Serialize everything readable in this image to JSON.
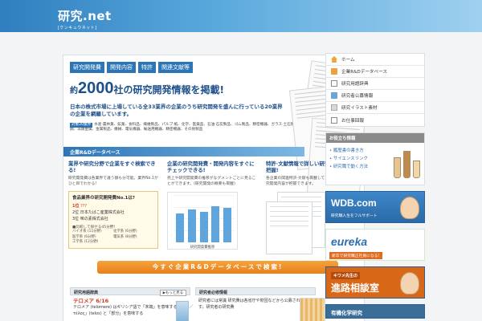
{
  "site": {
    "logo_main": "研究.net",
    "logo_sub": "[ケンキュウネット]"
  },
  "hero": {
    "tags": [
      "研究開発費",
      "開発内容",
      "特許",
      "関連文献等"
    ],
    "headline_pre": "約",
    "headline_num": "2000",
    "headline_post": "社の研究開発情報を掲載!",
    "subline": "日本の株式市場に上場している全33業界の企業のうち研究開発を盛んに行っている20業界の企業を網羅しています。",
    "industries_label": "対象20業界",
    "industries": "水産·農林業、鉱業、食料品、繊維製品、パルプ·紙、化学、医薬品、石油·石炭製品、ゴム製品、精密機器、ガラス·土石製品、鉄鋼、非鉄金属、金属製品、機械、電気機器、輸送用機器、精密機器、その他製品",
    "band": "企業R&Dデータベース",
    "cta": "今すぐ企業R&Dデータベースで検索!"
  },
  "columns": [
    {
      "title": "業界や研究分野で企業をすぐ検索できる!",
      "body": "研究開発費は各業界で違う額も分可能。業界No.1がひと目でわかる!"
    },
    {
      "title": "企業の研究開発費・開発内容をすぐにチェックできる!",
      "body": "売上や研究開発費の推移がなグメントごとに見ることができます。(研究開発の概要も掲載)",
      "chart_caption": "研究開発費推移"
    },
    {
      "title": "特許·文献情報で詳しい研究開発内容を把握!",
      "body": "各企業の関連特許·文献も掲載しています。詳しい研究開発内容が把握できます。"
    }
  ],
  "ranking": {
    "title": "食品業界の研究開発費No.1は?",
    "rows": [
      {
        "rank": "1位",
        "name": "???"
      },
      {
        "rank": "2位",
        "name": "日本たばこ産業株式会社"
      },
      {
        "rank": "3位",
        "name": "味の素株式会社"
      }
    ],
    "sub": "■比較して探せる45分野!",
    "grid": [
      "バイオ系 (11分野)",
      "化学系 (6分野)",
      "医学系 (6分野)",
      "電気系 (8分野)",
      "工学系 (12分野)",
      ""
    ]
  },
  "lower": {
    "glossary_title": "研究用語辞典",
    "glossary_more": "▶もっと見る",
    "word": "テロメア 6/16",
    "word_body": "テロメア (telomere) はギリシア語で「末端」を意味する「テロ／τέλος」(telos) と「部分」を意味する",
    "info_title": "研究者必修情報",
    "info_body": "研究者には常識 研究費は各省庁や財団などから公募されています。研究者の研究費"
  },
  "sidebar": {
    "nav": [
      {
        "label": "ホーム",
        "icon": "home-icon"
      },
      {
        "label": "企業R&Dデータベース",
        "icon": "folder-icon"
      },
      {
        "label": "研究用語辞典",
        "icon": "book-icon"
      },
      {
        "label": "研究者公募情報",
        "icon": "office-icon"
      },
      {
        "label": "研究イラスト素材",
        "icon": "pen-icon"
      },
      {
        "label": "お仕事回報",
        "icon": "mail-icon"
      }
    ],
    "help": {
      "title": "お役立ち情報",
      "links": [
        "履歴書の書き方",
        "サイエンスリンク",
        "研究職で動く方法"
      ]
    },
    "banners": {
      "wdb_title": "WDB.com",
      "wdb_sub": "研究職人生をフルサポート",
      "eureka_title": "eureka",
      "eureka_sub": "新卒で研究職正社員になる!",
      "kigu_top": "キワメ先生の",
      "kigu_title": "進路相談室",
      "last_title": "有機化学研究"
    }
  },
  "chart_data": {
    "type": "bar",
    "categories": [
      "2007",
      "2008",
      "2009",
      "2010",
      "2011"
    ],
    "values": [
      62,
      70,
      66,
      78,
      74
    ],
    "title": "研究開発費推移",
    "xlabel": "",
    "ylabel": "",
    "ylim": [
      0,
      100
    ],
    "grid": true
  }
}
